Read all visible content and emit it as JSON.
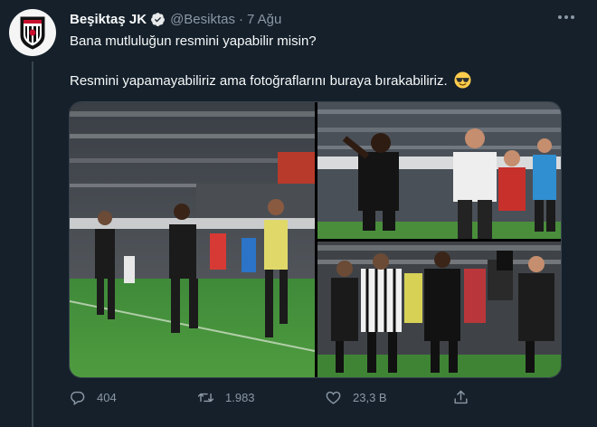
{
  "tweet": {
    "author_name": "Beşiktaş JK",
    "handle": "@Besiktas",
    "separator": "·",
    "date": "7 Ağu",
    "line1": "Bana mutluluğun resmini yapabilir misin?",
    "line2": "Resmini yapamayabiliriz ama fotoğraflarını buraya bırakabiliriz.",
    "emoji_icon": "sunglasses-emoji",
    "verified": true,
    "more_icon": "more-options-icon"
  },
  "media": {
    "count": 3,
    "photos": [
      {
        "name": "photo-team-celebration-run"
      },
      {
        "name": "photo-player-and-coach-celebrating"
      },
      {
        "name": "photo-players-group-hug"
      }
    ]
  },
  "actions": {
    "reply_count": "404",
    "retweet_count": "1.983",
    "like_count": "23,3 B",
    "share_icon": "share-icon"
  },
  "colors": {
    "background": "#15202b",
    "text": "#f7f9f9",
    "secondary_text": "#8b98a5",
    "verified": "#1d9bf0",
    "border": "#38444d"
  }
}
